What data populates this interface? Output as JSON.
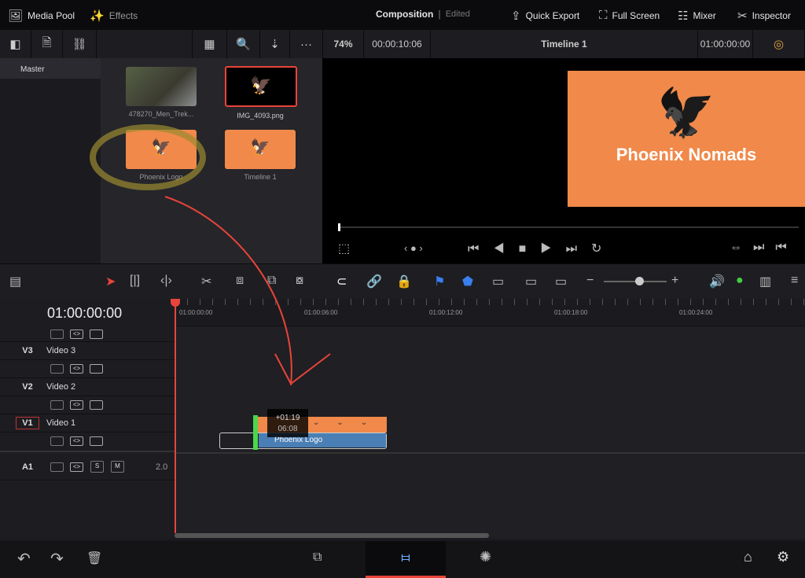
{
  "topbar": {
    "media_pool": "Media Pool",
    "effects": "Effects",
    "composition": "Composition",
    "edited": "Edited",
    "quick_export": "Quick Export",
    "full_screen": "Full Screen",
    "mixer": "Mixer",
    "inspector": "Inspector"
  },
  "toolbar": {
    "zoom": "74%",
    "duration": "00:00:10:06",
    "timeline_name": "Timeline 1",
    "timecode": "01:00:00:00"
  },
  "sidebar": {
    "items": [
      {
        "label": "Master"
      }
    ]
  },
  "media": [
    {
      "label": "478270_Men_Trek..."
    },
    {
      "label": "IMG_4093.png"
    },
    {
      "label": "Phoenix Logo"
    },
    {
      "label": "Timeline 1"
    }
  ],
  "viewer": {
    "title": "Phoenix Nomads",
    "bg_color": "#f0894a"
  },
  "timeline": {
    "timecode": "01:00:00:00",
    "ruler": [
      "01:00:00:00",
      "01:00:06:00",
      "01:00:12:00",
      "01:00:18:00",
      "01:00:24:00"
    ],
    "tracks": [
      {
        "id": "V3",
        "name": "Video 3"
      },
      {
        "id": "V2",
        "name": "Video 2"
      },
      {
        "id": "V1",
        "name": "Video 1"
      },
      {
        "id": "A1",
        "name": "",
        "level": "2.0"
      }
    ],
    "clip": {
      "name": "Phoenix Logo",
      "offset": "+01:19",
      "duration": "06:08"
    },
    "solo": "S",
    "mute": "M"
  },
  "colors": {
    "accent": "#e8443a",
    "clip_orange": "#f0894a",
    "clip_blue": "#4a7fb5"
  }
}
